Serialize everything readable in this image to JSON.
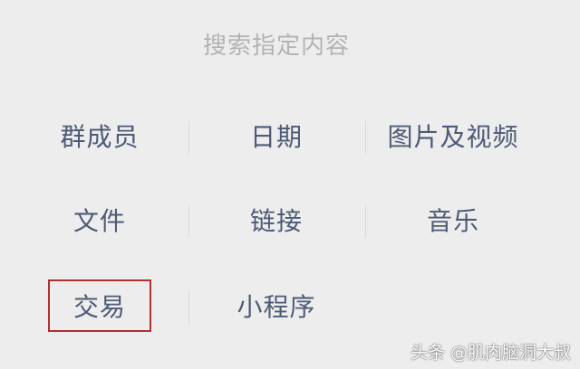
{
  "search": {
    "title": "搜索指定内容"
  },
  "categories": {
    "row1": [
      "群成员",
      "日期",
      "图片及视频"
    ],
    "row2": [
      "文件",
      "链接",
      "音乐"
    ],
    "row3": [
      "交易",
      "小程序"
    ]
  },
  "watermark": "头条 @肌肉脑洞大叔"
}
